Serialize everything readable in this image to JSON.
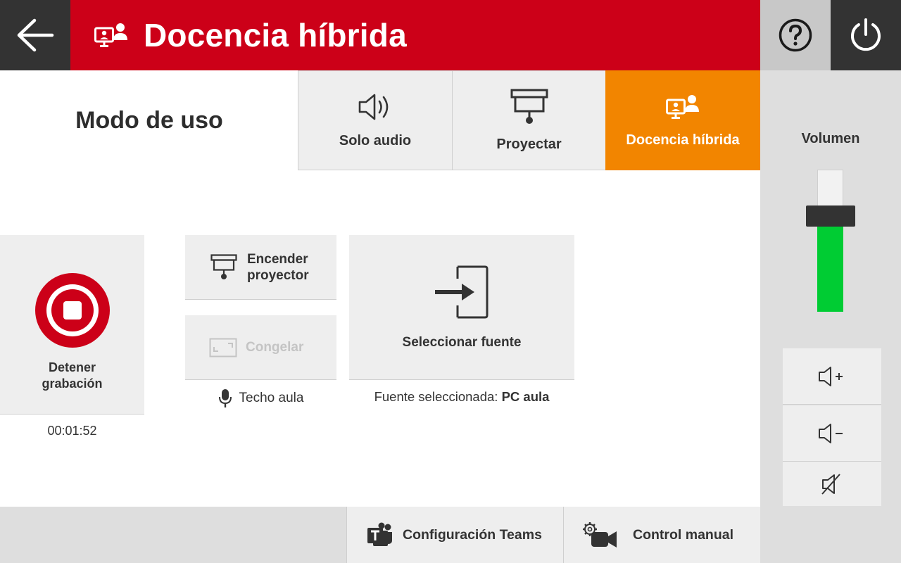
{
  "header": {
    "title": "Docencia híbrida",
    "back_icon": "arrow-left-icon",
    "help_icon": "help-circle-icon",
    "power_icon": "power-icon",
    "brand_color": "#cc0018"
  },
  "mode": {
    "label": "Modo de uso",
    "tabs": [
      {
        "label": "Solo audio",
        "icon": "speaker-icon",
        "active": false
      },
      {
        "label": "Proyectar",
        "icon": "projector-icon",
        "active": false
      },
      {
        "label": "Docencia híbrida",
        "icon": "hybrid-teaching-icon",
        "active": true
      }
    ],
    "active_color": "#f28500"
  },
  "recording": {
    "label": "Detener\ngrabación",
    "time": "00:01:52",
    "icon": "stop-record-icon"
  },
  "projector": {
    "label": "Encender\nproyector",
    "icon": "projector-icon"
  },
  "freeze": {
    "label": "Congelar",
    "icon": "freeze-frame-icon",
    "enabled": false
  },
  "microphone": {
    "label": "Techo aula",
    "icon": "microphone-icon"
  },
  "source": {
    "button_label": "Seleccionar fuente",
    "selected_prefix": "Fuente seleccionada:",
    "selected_value": "PC aula",
    "icon": "input-source-icon"
  },
  "volume": {
    "label": "Volumen",
    "level": 0.64,
    "fill_color": "#00cc33",
    "buttons": [
      {
        "icon": "volume-up-icon"
      },
      {
        "icon": "volume-down-icon"
      },
      {
        "icon": "mute-icon"
      }
    ]
  },
  "bottom": {
    "teams_label": "Configuración Teams",
    "teams_icon": "teams-icon",
    "manual_label": "Control manual",
    "manual_icon": "camera-settings-icon"
  }
}
